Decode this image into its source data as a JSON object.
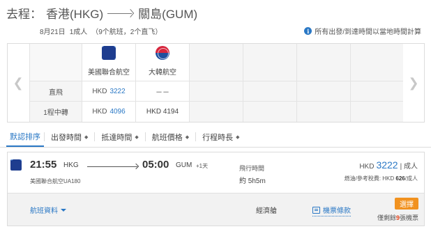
{
  "header": {
    "trip_label": "去程：",
    "origin": "香港(HKG)",
    "destination": "關島(GUM)",
    "date": "8月21日",
    "passengers": "1成人",
    "summary": "（9个航班，2个直飞）",
    "time_note": "所有出發/到達時間以當地時間計算"
  },
  "matrix": {
    "row_labels": [
      "直飛",
      "1程中轉"
    ],
    "airlines": [
      {
        "name": "美國聯合航空",
        "logo": "united-airlines-logo",
        "direct": {
          "currency": "HKD",
          "price": "3222"
        },
        "one_stop": {
          "currency": "HKD",
          "price": "4096"
        }
      },
      {
        "name": "大韓航空",
        "logo": "korean-air-logo",
        "direct": {
          "text": "－－"
        },
        "one_stop": {
          "text": "HKD 4194"
        }
      }
    ]
  },
  "sort": {
    "items": [
      "默認排序",
      "出發時間",
      "抵達時間",
      "航班價格",
      "行程時長"
    ],
    "active": "默認排序"
  },
  "flight": {
    "dep_time": "21:55",
    "dep_code": "HKG",
    "arr_time": "05:00",
    "arr_code": "GUM",
    "plus_day": "+1天",
    "airline_flight": "美國聯合航空UA180",
    "duration_label": "飛行時間",
    "duration": "約 5h5m",
    "currency": "HKD",
    "price": "3222",
    "price_unit": "| 成人",
    "tax_label": "燃油/參考稅費: HKD",
    "tax_value": "626",
    "tax_unit": "/成人",
    "flight_info": "航班資料",
    "cabin": "經濟艙",
    "rules": "機票條款",
    "select": "選擇",
    "seats_prefix": "僅剩餘",
    "seats_count": "9",
    "seats_suffix": "張機票"
  },
  "colors": {
    "accent_blue": "#2a78c5",
    "select_orange": "#f19220",
    "seats_red": "#e2431c"
  }
}
